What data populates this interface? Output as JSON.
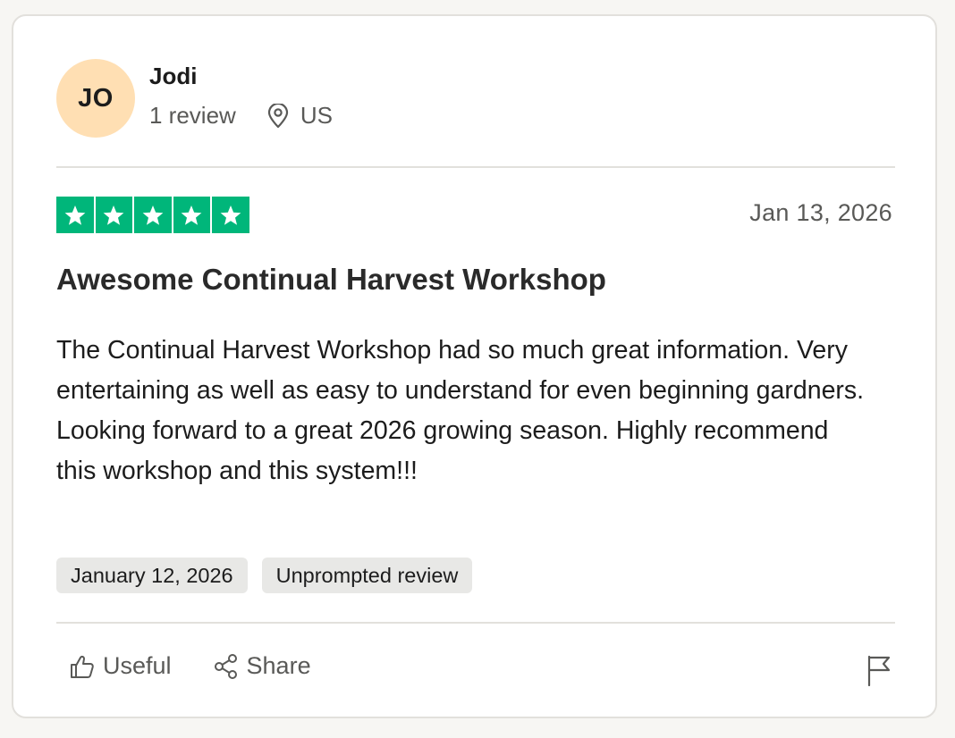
{
  "reviewer": {
    "initials": "JO",
    "name": "Jodi",
    "review_count": "1 review",
    "country": "US"
  },
  "review": {
    "rating": 5,
    "date": "Jan 13, 2026",
    "title": "Awesome Continual Harvest Workshop",
    "body": "The Continual Harvest Workshop had so much great information. Very entertaining as well as easy to understand for even beginning gardners. Looking forward to a great 2026 growing season. Highly recommend this workshop and this system!!!",
    "tags": {
      "experience_date": "January 12, 2026",
      "source": "Unprompted review"
    }
  },
  "actions": {
    "useful_label": "Useful",
    "share_label": "Share"
  },
  "icons": {
    "location": "map-pin-icon",
    "useful": "thumbs-up-icon",
    "share": "share-icon",
    "report": "flag-icon",
    "star": "star-icon"
  },
  "colors": {
    "star_green": "#00b67a",
    "avatar_bg": "#ffdfb3"
  }
}
